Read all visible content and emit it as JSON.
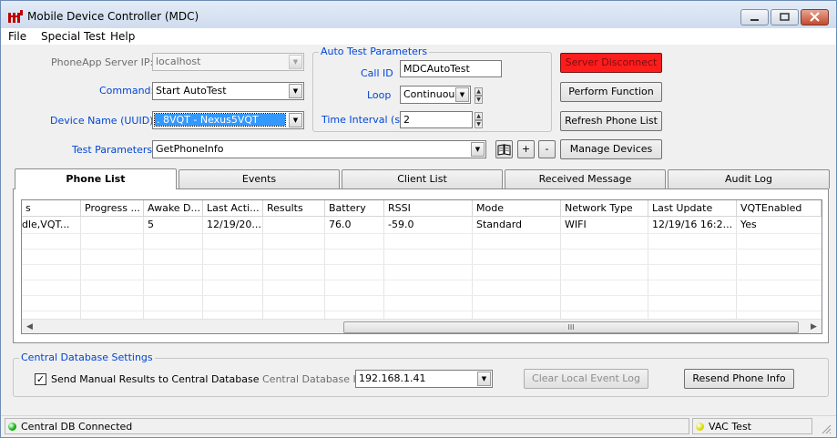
{
  "window": {
    "title": "Mobile Device Controller (MDC)"
  },
  "menu": [
    "File",
    "Special Test",
    "Help"
  ],
  "form": {
    "server_ip_label": "PhoneApp Server  IP:",
    "server_ip_value": "localhost",
    "command_label": "Command:",
    "command_value": "Start AutoTest",
    "device_label": "Device Name (UUID):",
    "device_value": ". 8VQT - Nexus5VQT",
    "test_params_label": "Test Parameters:",
    "test_params_value": "GetPhoneInfo"
  },
  "auto_test": {
    "title": "Auto Test Parameters",
    "call_id_label": "Call ID",
    "call_id_value": "MDCAutoTest",
    "loop_label": "Loop",
    "loop_value": "Continuous",
    "interval_label": "Time Interval (s)",
    "interval_value": "2"
  },
  "buttons": {
    "server_disconnect": "Server Disconnect",
    "perform_function": "Perform Function",
    "refresh_phone_list": "Refresh Phone List",
    "manage_devices": "Manage Devices",
    "plus": "+",
    "minus": "-"
  },
  "tabs": [
    "Phone List",
    "Events",
    "Client List",
    "Received Message",
    "Audit Log"
  ],
  "grid": {
    "columns": [
      "s",
      "Progress ...",
      "Awake D...",
      "Last Acti...",
      "Results",
      "Battery",
      "RSSI",
      "Mode",
      "Network Type",
      "Last Update",
      "VQTEnabled"
    ],
    "rows": [
      [
        "dle,VQT...",
        "",
        "5",
        "12/19/20...",
        "",
        "76.0",
        "-59.0",
        "Standard",
        "WIFI",
        "12/19/16 16:2...",
        "Yes"
      ]
    ],
    "scroll_grip": "III"
  },
  "central_db": {
    "title": "Central Database Settings",
    "send_manual_label": "Send Manual Results to Central Database",
    "send_manual_checked": true,
    "ip_label": "Central Database IP:",
    "ip_value": "192.168.1.41",
    "clear_log": "Clear Local Event Log",
    "resend_info": "Resend Phone Info"
  },
  "status": {
    "left": "Central DB Connected",
    "right": "VAC Test",
    "left_color": "#00b000",
    "right_color": "#d8d800"
  }
}
